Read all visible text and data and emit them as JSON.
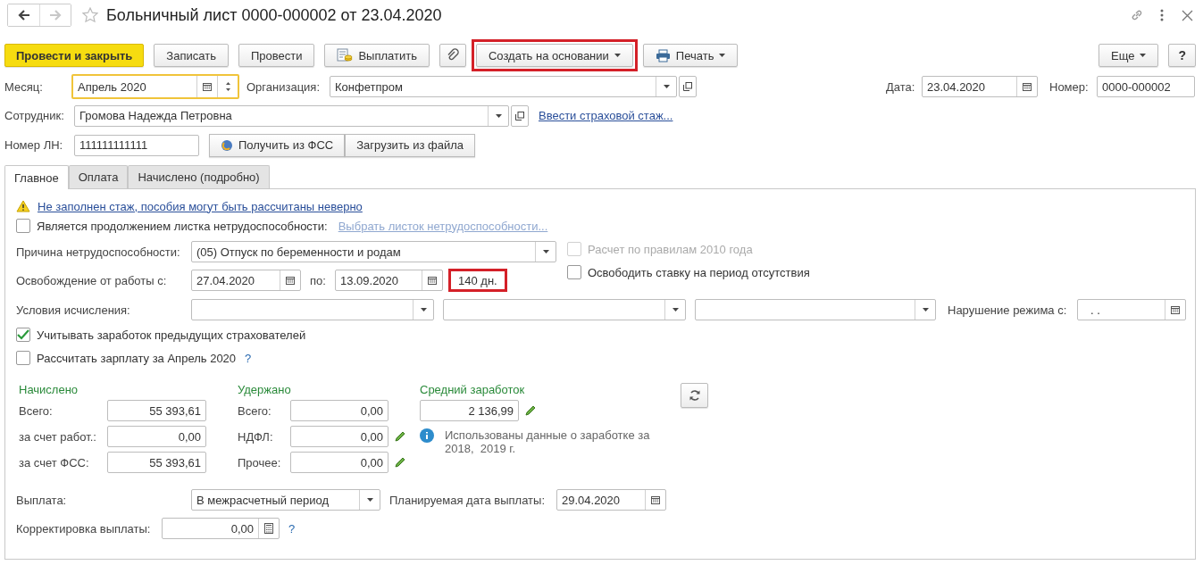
{
  "window": {
    "title": "Больничный лист 0000-000002 от 23.04.2020",
    "forward_enabled": false
  },
  "toolbar": [
    {
      "kind": "primary",
      "label": "Провести и закрыть",
      "highlighted": false
    },
    {
      "kind": "plain",
      "label": "Записать",
      "highlighted": false
    },
    {
      "kind": "plain",
      "label": "Провести",
      "highlighted": false
    },
    {
      "kind": "pay",
      "label": "Выплатить",
      "highlighted": false
    },
    {
      "kind": "attach",
      "highlighted": false
    },
    {
      "kind": "menu",
      "label": "Создать на основании",
      "highlighted": true
    },
    {
      "kind": "print",
      "label": "Печать",
      "highlighted": false
    }
  ],
  "toolbar_right": [
    {
      "kind": "menu",
      "label": "Еще"
    },
    {
      "kind": "help",
      "label": "?"
    }
  ],
  "month": {
    "label": "Месяц:",
    "value": "Апрель 2020",
    "focused": true
  },
  "organization": {
    "label": "Организация:",
    "value": "Конфетпром"
  },
  "date": {
    "label": "Дата:",
    "value": "23.04.2020"
  },
  "number": {
    "label": "Номер:",
    "value": "0000-000002"
  },
  "employee": {
    "label": "Сотрудник:",
    "value": "Громова Надежда Петровна",
    "link": "Ввести страховой стаж..."
  },
  "sick_note": {
    "label": "Номер ЛН:",
    "value": "111111111111",
    "buttons": [
      "Получить из ФСС",
      "Загрузить из файла"
    ]
  },
  "tabs": [
    {
      "label": "Главное",
      "selected": true
    },
    {
      "label": "Оплата",
      "selected": false
    },
    {
      "label": "Начислено (подробно)",
      "selected": false
    }
  ],
  "main": {
    "warning": "Не заполнен стаж, пособия могут быть рассчитаны неверно",
    "continuation": {
      "label": "Является продолжением листка нетрудоспособности:",
      "checked": false,
      "link": "Выбрать листок нетрудоспособности..."
    },
    "reason": {
      "label": "Причина нетрудоспособности:",
      "value": "(05) Отпуск по беременности и родам"
    },
    "rules_2010": {
      "label": "Расчет по правилам 2010 года",
      "checked": false,
      "disabled": true
    },
    "free_rate": {
      "label": "Освободить ставку на период отсутствия",
      "checked": false,
      "disabled": false
    },
    "release": {
      "label": "Освобождение от работы с:",
      "from": "27.04.2020",
      "to_label": "по:",
      "to": "13.09.2020",
      "days": "140 дн.",
      "days_highlighted": true
    },
    "conditions": {
      "label": "Условия исчисления:"
    },
    "violation": {
      "label": "Нарушение режима с:",
      "value": ". ."
    },
    "prev_insurers": {
      "label": "Учитывать заработок предыдущих страхователей",
      "checked": true
    },
    "recalc": {
      "label": "Рассчитать зарплату за Апрель 2020",
      "checked": false,
      "help": "?"
    },
    "accrued": {
      "title": "Начислено",
      "rows": [
        {
          "label": "Всего:",
          "value": "55 393,61"
        },
        {
          "label": "за счет работ.:",
          "value": "0,00"
        },
        {
          "label": "за счет ФСС:",
          "value": "55 393,61"
        }
      ]
    },
    "withheld": {
      "title": "Удержано",
      "rows": [
        {
          "label": "Всего:",
          "value": "0,00",
          "editable": false
        },
        {
          "label": "НДФЛ:",
          "value": "0,00",
          "editable": true
        },
        {
          "label": "Прочее:",
          "value": "0,00",
          "editable": true
        }
      ]
    },
    "average": {
      "title": "Средний заработок",
      "value": "2 136,99",
      "editable": true,
      "note": "Использованы данные о заработке за 2018,  2019 г."
    },
    "payment": {
      "label": "Выплата:",
      "value": "В межрасчетный период",
      "date_label": "Планируемая дата выплаты:",
      "date": "29.04.2020"
    },
    "correction": {
      "label": "Корректировка выплаты:",
      "value": "0,00",
      "help": "?"
    }
  }
}
